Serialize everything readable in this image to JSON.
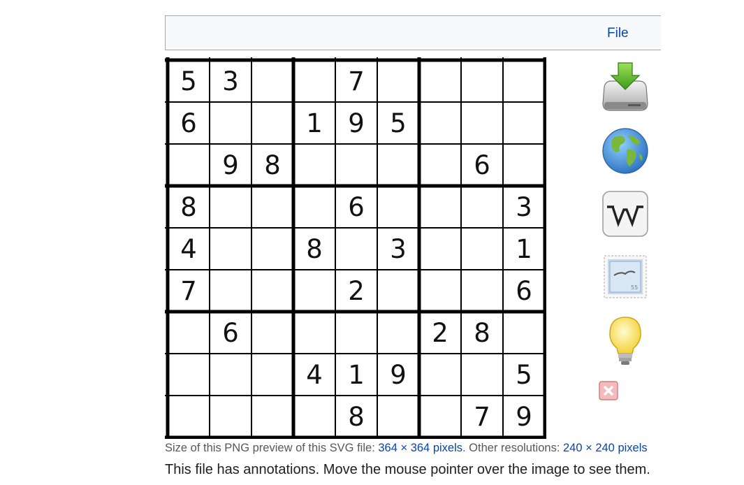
{
  "tabs": {
    "file_label": "File"
  },
  "sudoku": {
    "rows": [
      [
        "5",
        "3",
        "",
        "",
        "7",
        "",
        "",
        "",
        ""
      ],
      [
        "6",
        "",
        "",
        "1",
        "9",
        "5",
        "",
        "",
        ""
      ],
      [
        "",
        "9",
        "8",
        "",
        "",
        "",
        "",
        "6",
        ""
      ],
      [
        "8",
        "",
        "",
        "",
        "6",
        "",
        "",
        "",
        "3"
      ],
      [
        "4",
        "",
        "",
        "8",
        "",
        "3",
        "",
        "",
        "1"
      ],
      [
        "7",
        "",
        "",
        "",
        "2",
        "",
        "",
        "",
        "6"
      ],
      [
        "",
        "6",
        "",
        "",
        "",
        "",
        "2",
        "8",
        ""
      ],
      [
        "",
        "",
        "",
        "4",
        "1",
        "9",
        "",
        "",
        "5"
      ],
      [
        "",
        "",
        "",
        "",
        "8",
        "",
        "",
        "7",
        "9"
      ]
    ]
  },
  "annotation_icons": [
    "download-drive-icon",
    "globe-icon",
    "wikipedia-icon",
    "stamp-icon",
    "lightbulb-icon",
    "close-icon"
  ],
  "caption": {
    "prefix": "Size of this PNG preview of this SVG file: ",
    "preview_size_link": "364 × 364 pixels",
    "middle": ". Other resolutions: ",
    "other_resolution_link": "240 × 240 pixels"
  },
  "annotation_note": "This file has annotations. Move the mouse pointer over the image to see them."
}
